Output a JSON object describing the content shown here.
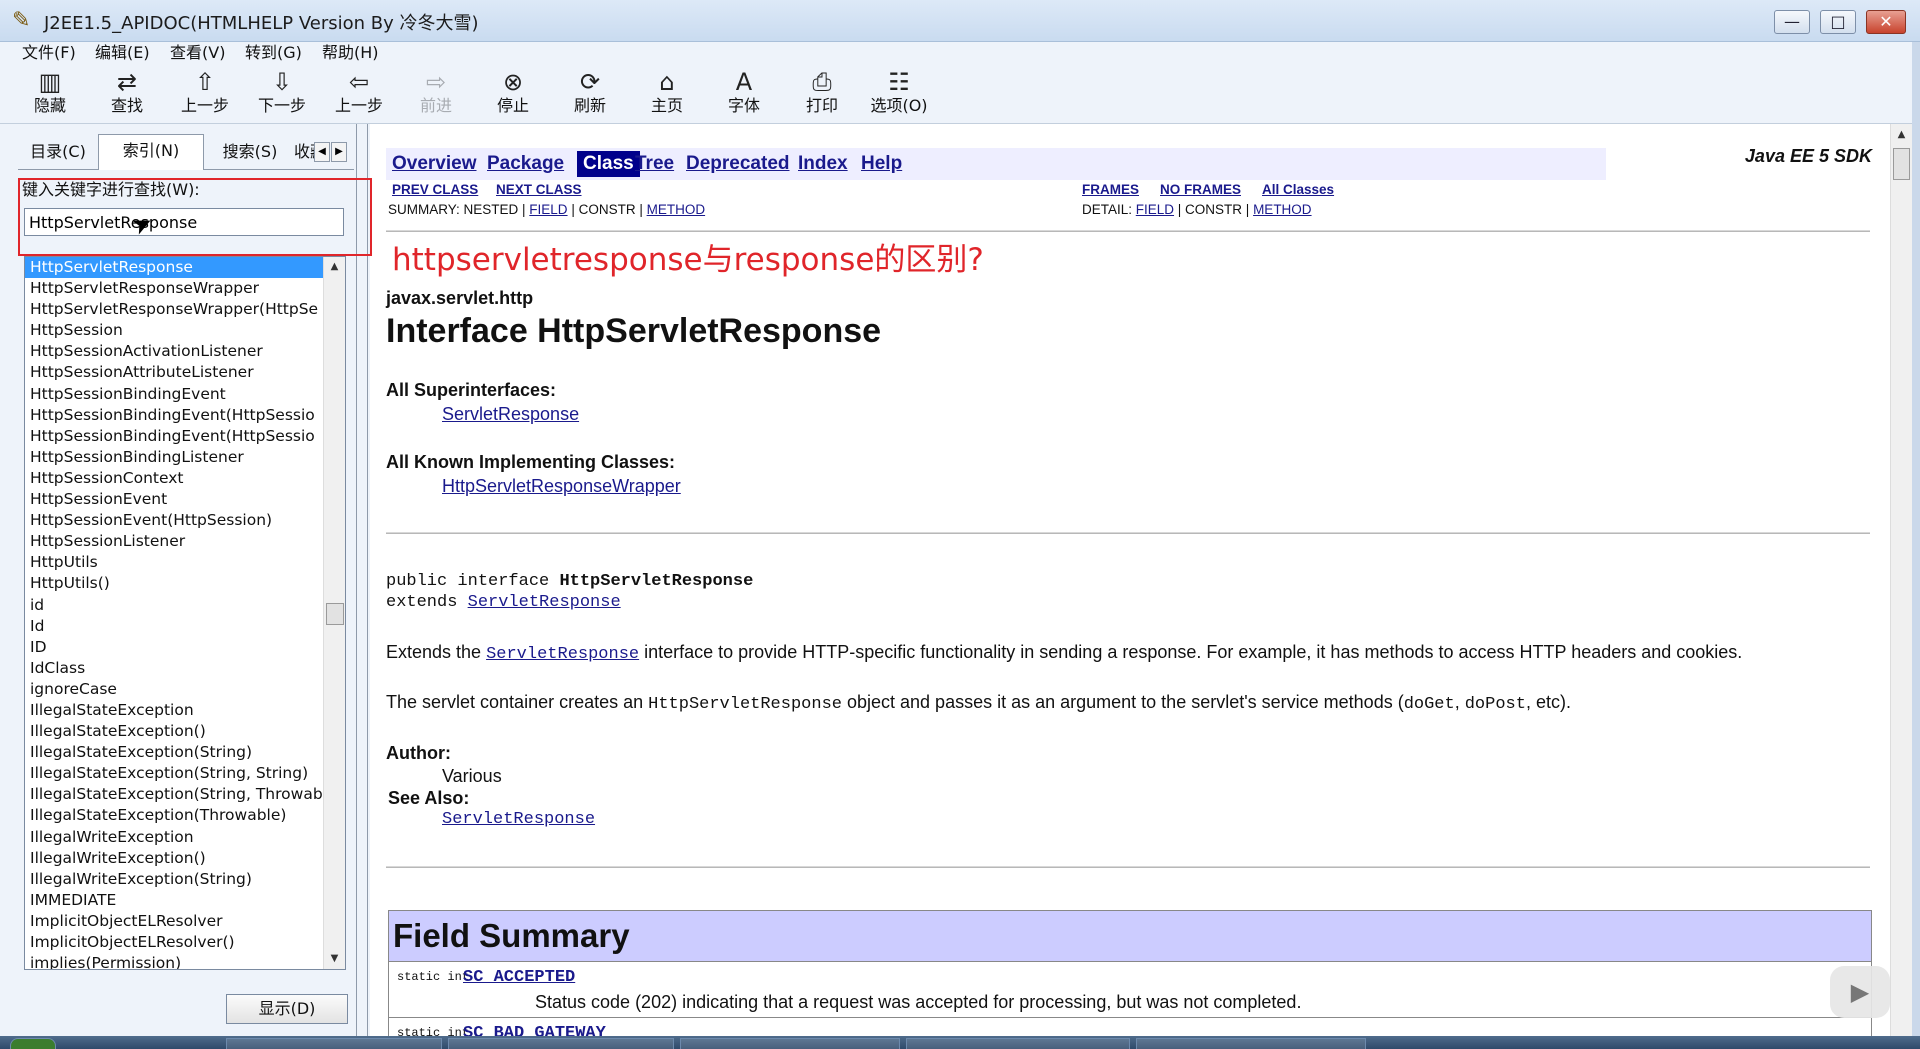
{
  "window": {
    "title": "J2EE1.5_APIDOC(HTMLHELP Version By 冷冬大雪)",
    "minimize": "—",
    "maximize": "□",
    "close": "✕"
  },
  "menu": [
    "文件(F)",
    "编辑(E)",
    "查看(V)",
    "转到(G)",
    "帮助(H)"
  ],
  "toolbar": [
    {
      "label": "隐藏",
      "icon": "hide-icon",
      "glyph": "▥",
      "disabled": false
    },
    {
      "label": "查找",
      "icon": "find-icon",
      "glyph": "⇄",
      "disabled": false
    },
    {
      "label": "上一步",
      "icon": "arrow-up-icon",
      "glyph": "⇧",
      "disabled": false
    },
    {
      "label": "下一步",
      "icon": "arrow-down-icon",
      "glyph": "⇩",
      "disabled": false
    },
    {
      "label": "上一步",
      "icon": "arrow-left-icon",
      "glyph": "⇦",
      "disabled": false
    },
    {
      "label": "前进",
      "icon": "arrow-right-icon",
      "glyph": "⇨",
      "disabled": true
    },
    {
      "label": "停止",
      "icon": "stop-icon",
      "glyph": "⊗",
      "disabled": false
    },
    {
      "label": "刷新",
      "icon": "refresh-icon",
      "glyph": "⟳",
      "disabled": false
    },
    {
      "label": "主页",
      "icon": "home-icon",
      "glyph": "⌂",
      "disabled": false
    },
    {
      "label": "字体",
      "icon": "font-icon",
      "glyph": "A",
      "disabled": false
    },
    {
      "label": "打印",
      "icon": "print-icon",
      "glyph": "⎙",
      "disabled": false
    },
    {
      "label": "选项(O)",
      "icon": "options-icon",
      "glyph": "☷",
      "disabled": false
    }
  ],
  "left": {
    "tabs": [
      "目录(C)",
      "索引(N)",
      "搜索(S)",
      "收藏"
    ],
    "selected_tab": "索引(N)",
    "keyword_label": "键入关键字进行查找(W):",
    "keyword_value": "HttpServletResponse",
    "list_items": [
      "HttpServletResponse",
      "HttpServletResponseWrapper",
      "HttpServletResponseWrapper(HttpSe",
      "HttpSession",
      "HttpSessionActivationListener",
      "HttpSessionAttributeListener",
      "HttpSessionBindingEvent",
      "HttpSessionBindingEvent(HttpSessio",
      "HttpSessionBindingEvent(HttpSessio",
      "HttpSessionBindingListener",
      "HttpSessionContext",
      "HttpSessionEvent",
      "HttpSessionEvent(HttpSession)",
      "HttpSessionListener",
      "HttpUtils",
      "HttpUtils()",
      "id",
      "Id",
      "ID",
      "IdClass",
      "ignoreCase",
      "IllegalStateException",
      "IllegalStateException()",
      "IllegalStateException(String)",
      "IllegalStateException(String, String)",
      "IllegalStateException(String, Throwab",
      "IllegalStateException(Throwable)",
      "IllegalWriteException",
      "IllegalWriteException()",
      "IllegalWriteException(String)",
      "IMMEDIATE",
      "ImplicitObjectELResolver",
      "ImplicitObjectELResolver()",
      "implies(Permission)"
    ],
    "selected_index": 0,
    "show_button": "显示(D)"
  },
  "doc": {
    "nav": [
      "Overview",
      "Package",
      "Class",
      "Tree",
      "Deprecated",
      "Index",
      "Help"
    ],
    "current_nav": "Class",
    "sdk": "Java EE 5 SDK",
    "prev_class": "PREV CLASS",
    "next_class": "NEXT CLASS",
    "frames": "FRAMES",
    "no_frames": "NO FRAMES",
    "all_classes": "All Classes",
    "summary_prefix": "SUMMARY: NESTED | ",
    "summary_field": "FIELD",
    "summary_mid": " | CONSTR | ",
    "summary_method": "METHOD",
    "detail_prefix": "DETAIL: ",
    "detail_field": "FIELD",
    "detail_mid": " | CONSTR | ",
    "detail_method": "METHOD",
    "annotation": "httpservletresponse与response的区别?",
    "package": "javax.servlet.http",
    "title": "Interface HttpServletResponse",
    "superinterfaces_label": "All Superinterfaces:",
    "superinterface": "ServletResponse",
    "implementing_label": "All Known Implementing Classes:",
    "implementing_class": "HttpServletResponseWrapper",
    "decl_prefix": "public interface ",
    "decl_name": "HttpServletResponse",
    "extends_prefix": "extends ",
    "extends_name": "ServletResponse",
    "p1_pre": "Extends the ",
    "p1_link": "ServletResponse",
    "p1_post": " interface to provide HTTP-specific functionality in sending a response. For example, it has methods to access HTTP headers and cookies.",
    "p2_pre": "The servlet container creates an ",
    "p2_code": "HttpServletResponse",
    "p2_mid": " object and passes it as an argument to the servlet's service methods (",
    "p2_code2": "doGet",
    "p2_sep": ", ",
    "p2_code3": "doPost",
    "p2_post": ", etc).",
    "author_label": "Author:",
    "author": "Various",
    "see_also_label": "See Also:",
    "see_also": "ServletResponse",
    "field_summary": "Field Summary",
    "field1_type": "static int",
    "field1_name": "SC_ACCEPTED",
    "field1_desc": "Status code (202) indicating that a request was accepted for processing, but was not completed.",
    "field2_type": "static int",
    "field2_name": "SC_BAD_GATEWAY"
  },
  "colors": {
    "accent_red": "#e0252a",
    "selection": "#3399ff",
    "nav_background": "#eeeeff",
    "table_header": "#ccccff"
  }
}
